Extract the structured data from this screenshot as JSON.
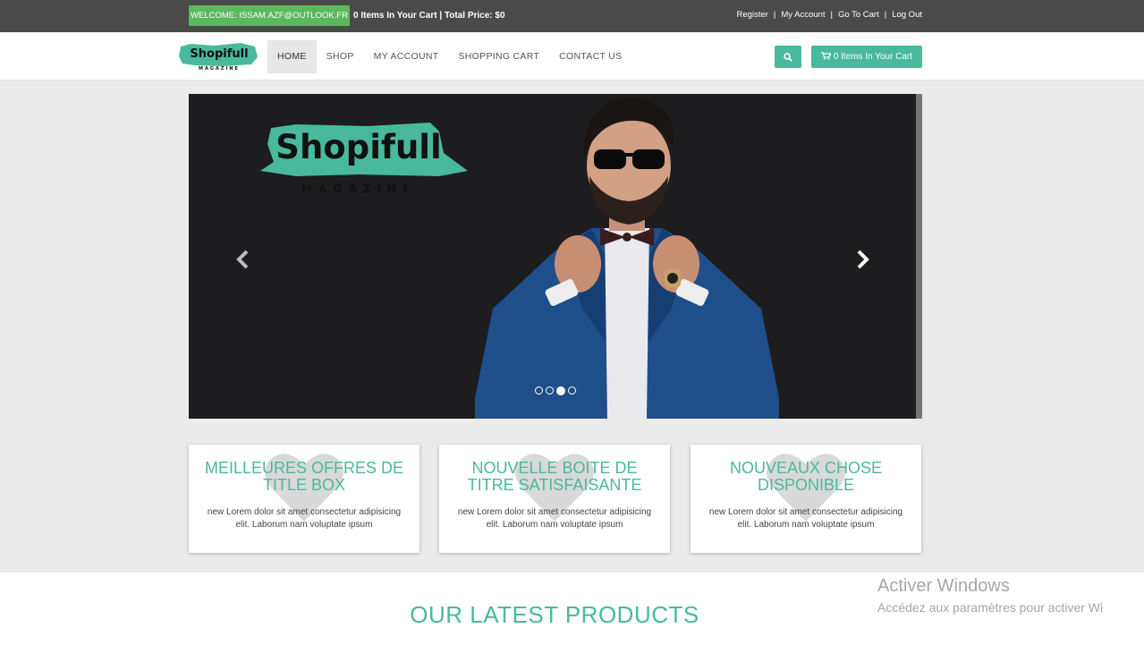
{
  "topbar": {
    "welcome": "WELCOME: ISSAM.AZF@OUTLOOK.FR",
    "cart_info": "0 Items In Your Cart | Total Price: $0",
    "links": [
      "Register",
      "My Account",
      "Go To Cart",
      "Log Out"
    ]
  },
  "navbar": {
    "logo_text": "Shopifull",
    "logo_subtext": "MAGAZINE",
    "items": [
      "HOME",
      "SHOP",
      "MY ACCOUNT",
      "SHOPPING CART",
      "CONTACT US"
    ],
    "active_item": "HOME",
    "search_icon": "search-icon",
    "cart_button_label": "0 Items In Your Cart"
  },
  "carousel": {
    "logo_text": "Shopifull",
    "logo_subtext": "MAGAZINE",
    "prev_icon": "chevron-left-icon",
    "next_icon": "chevron-right-icon",
    "slide_count": 4,
    "active_slide": 3
  },
  "boxes": [
    {
      "title": "MEILLEURES OFFRES DE TITLE BOX",
      "text": "new Lorem dolor sit amet consectetur adipisicing elit. Laborum nam voluptate ipsum",
      "icon": "heart-icon"
    },
    {
      "title": "NOUVELLE BOITE DE TITRE SATISFAISANTE",
      "text": "new Lorem dolor sit amet consectetur adipisicing elit. Laborum nam voluptate ipsum",
      "icon": "heart-icon"
    },
    {
      "title": "NOUVEAUX CHOSE DISPONIBLE",
      "text": "new Lorem dolor sit amet consectetur adipisicing elit. Laborum nam voluptate ipsum",
      "icon": "heart-icon"
    }
  ],
  "latest": {
    "title": "OUR LATEST PRODUCTS"
  },
  "windows_watermark": {
    "title": "Activer Windows",
    "subtitle": "Accédez aux paramètres pour activer Wi"
  },
  "colors": {
    "accent": "#49b99c",
    "welcome_bg": "#5cb85c",
    "topbar_bg": "#4a4a4a",
    "page_bg": "#ebebeb",
    "carousel_bg": "#1d1c1e"
  }
}
